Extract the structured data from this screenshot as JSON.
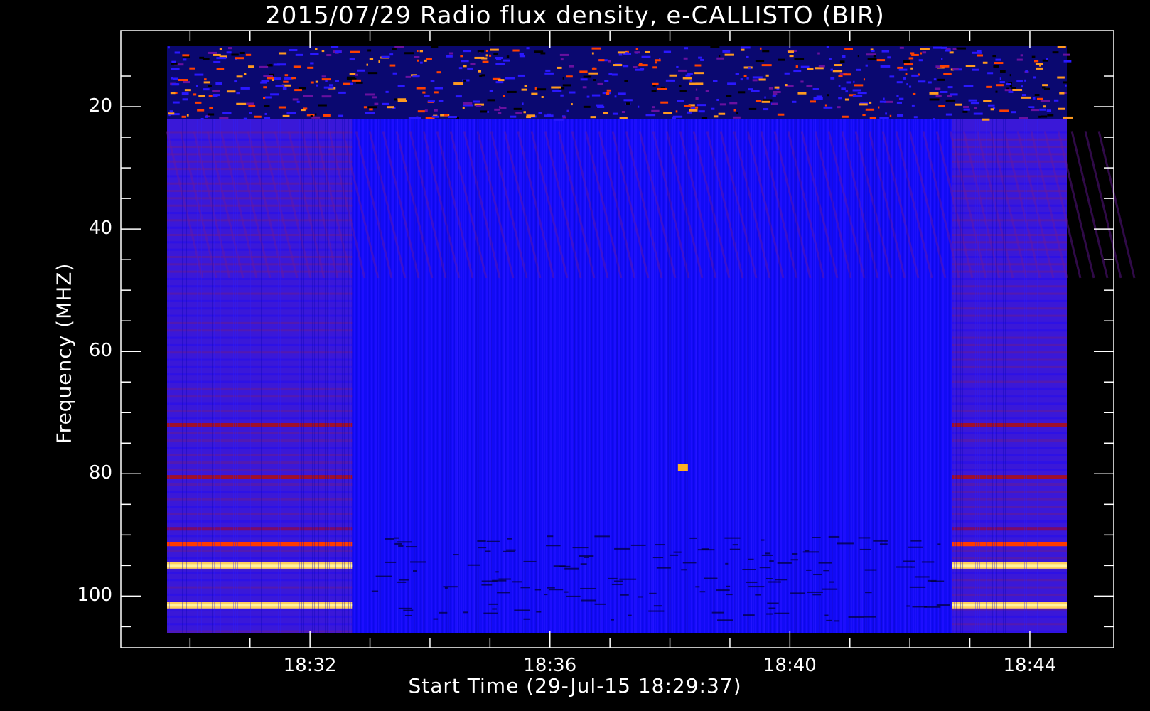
{
  "chart_data": {
    "type": "heatmap",
    "title": "2015/07/29  Radio flux density, e-CALLISTO (BIR)",
    "xlabel": "Start Time (29-Jul-15 18:29:37)",
    "ylabel": "Frequency (MHZ)",
    "x_range": [
      "18:29:37",
      "18:44:37"
    ],
    "x_ticks": [
      "18:32",
      "18:36",
      "18:40",
      "18:44"
    ],
    "y_range_mhz": [
      10,
      106
    ],
    "y_axis_inverted": true,
    "y_ticks": [
      20,
      40,
      60,
      80,
      100
    ],
    "colormap": [
      "#000000",
      "#0000ff",
      "#800080",
      "#ff3000",
      "#ffff80"
    ],
    "background": "#0000ff",
    "time_segments": [
      {
        "start": "18:29:37",
        "end": "18:32:42",
        "state": "calibration-banded"
      },
      {
        "start": "18:32:42",
        "end": "18:42:42",
        "state": "observation"
      },
      {
        "start": "18:42:42",
        "end": "18:44:37",
        "state": "calibration-banded"
      }
    ],
    "rfi_bands_mhz": [
      {
        "freq": 72,
        "intensity": "medium"
      },
      {
        "freq": 80.5,
        "intensity": "medium"
      },
      {
        "freq": 89,
        "intensity": "low"
      },
      {
        "freq": 91.5,
        "intensity": "high"
      },
      {
        "freq": 95,
        "intensity": "very-high"
      },
      {
        "freq": 101.5,
        "intensity": "very-high"
      }
    ],
    "features": [
      {
        "label": "low-frequency interference",
        "freq_range": [
          10,
          22
        ],
        "intensity": "high"
      },
      {
        "label": "spot",
        "time": "18:38:13",
        "freq": 79,
        "intensity": "high"
      }
    ],
    "grid": false
  }
}
